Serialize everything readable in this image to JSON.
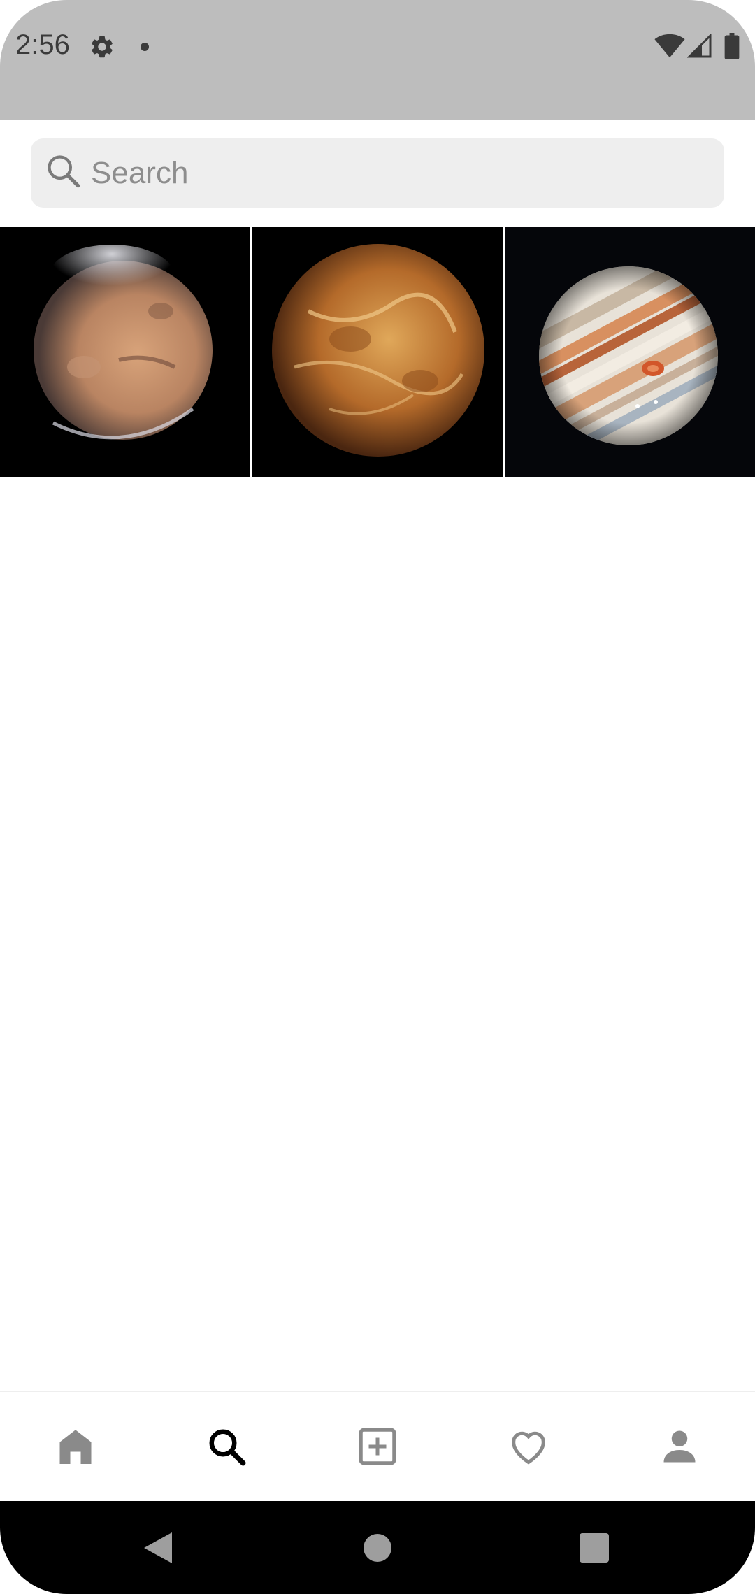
{
  "status_bar": {
    "time": "2:56",
    "icons": [
      "gear-icon",
      "notification-dot-icon",
      "wifi-icon",
      "signal-icon",
      "battery-icon"
    ]
  },
  "search": {
    "placeholder": "Search",
    "value": ""
  },
  "grid": {
    "photos": [
      {
        "subject": "mars-photo"
      },
      {
        "subject": "venus-photo"
      },
      {
        "subject": "jupiter-photo"
      }
    ]
  },
  "bottom_nav": {
    "items": [
      {
        "icon": "home-icon",
        "active": false
      },
      {
        "icon": "search-icon",
        "active": true
      },
      {
        "icon": "add-post-icon",
        "active": false
      },
      {
        "icon": "heart-icon",
        "active": false
      },
      {
        "icon": "profile-icon",
        "active": false
      }
    ],
    "active_color": "#000000",
    "inactive_color": "#8a8a8a"
  },
  "system_nav": {
    "buttons": [
      "back-icon",
      "home-circle-icon",
      "recents-icon"
    ]
  },
  "colors": {
    "status_bar_bg": "#bdbdbd",
    "search_bg": "#eeeeee",
    "system_nav_bg": "#000000"
  }
}
